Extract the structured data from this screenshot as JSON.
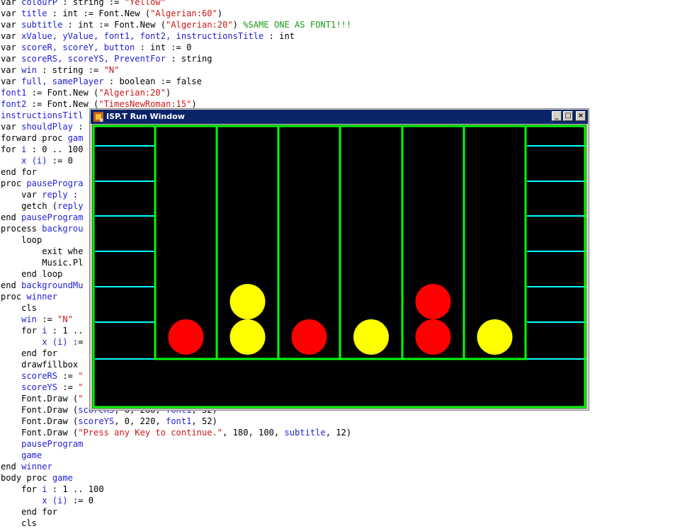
{
  "code_lines": [
    [
      {
        "t": "var ",
        "c": "kw"
      },
      {
        "t": "colourP",
        "c": "id"
      },
      {
        "t": " : string := ",
        "c": "kw"
      },
      {
        "t": "\"Yellow\"",
        "c": "str"
      }
    ],
    [
      {
        "t": "var ",
        "c": "kw"
      },
      {
        "t": "title",
        "c": "id"
      },
      {
        "t": " : int := Font.New (",
        "c": "kw"
      },
      {
        "t": "\"Algerian:60\"",
        "c": "str"
      },
      {
        "t": ")",
        "c": "kw"
      }
    ],
    [
      {
        "t": "var ",
        "c": "kw"
      },
      {
        "t": "subtitle",
        "c": "id"
      },
      {
        "t": " : int := Font.New (",
        "c": "kw"
      },
      {
        "t": "\"Algerian:20\"",
        "c": "str"
      },
      {
        "t": ") ",
        "c": "kw"
      },
      {
        "t": "%SAME ONE AS FONT1!!!",
        "c": "cm"
      }
    ],
    [
      {
        "t": "var ",
        "c": "kw"
      },
      {
        "t": "xValue, yValue, font1, font2, instructionsTitle",
        "c": "id"
      },
      {
        "t": " : int",
        "c": "kw"
      }
    ],
    [
      {
        "t": "var ",
        "c": "kw"
      },
      {
        "t": "scoreR, scoreY, button",
        "c": "id"
      },
      {
        "t": " : int := 0",
        "c": "kw"
      }
    ],
    [
      {
        "t": "var ",
        "c": "kw"
      },
      {
        "t": "scoreRS, scoreYS, PreventFor",
        "c": "id"
      },
      {
        "t": " : string",
        "c": "kw"
      }
    ],
    [
      {
        "t": "var ",
        "c": "kw"
      },
      {
        "t": "win",
        "c": "id"
      },
      {
        "t": " : string := ",
        "c": "kw"
      },
      {
        "t": "\"N\"",
        "c": "str"
      }
    ],
    [
      {
        "t": "var ",
        "c": "kw"
      },
      {
        "t": "full, samePlayer",
        "c": "id"
      },
      {
        "t": " : boolean := false",
        "c": "kw"
      }
    ],
    [
      {
        "t": "font1",
        "c": "id"
      },
      {
        "t": " := Font.New (",
        "c": "kw"
      },
      {
        "t": "\"Algerian:20\"",
        "c": "str"
      },
      {
        "t": ")",
        "c": "kw"
      }
    ],
    [
      {
        "t": "font2",
        "c": "id"
      },
      {
        "t": " := Font.New (",
        "c": "kw"
      },
      {
        "t": "\"TimesNewRoman:15\"",
        "c": "str"
      },
      {
        "t": ")",
        "c": "kw"
      }
    ],
    [
      {
        "t": "instructionsTitl",
        "c": "id"
      }
    ],
    [
      {
        "t": "var ",
        "c": "kw"
      },
      {
        "t": "shouldPlay",
        "c": "id"
      },
      {
        "t": " :",
        "c": "kw"
      }
    ],
    [
      {
        "t": "forward proc ",
        "c": "kw"
      },
      {
        "t": "gam",
        "c": "id"
      }
    ],
    [
      {
        "t": "for ",
        "c": "kw"
      },
      {
        "t": "i",
        "c": "id"
      },
      {
        "t": " : 0 .. 100",
        "c": "kw"
      }
    ],
    [
      {
        "t": "    ",
        "c": "kw"
      },
      {
        "t": "x (i)",
        "c": "id"
      },
      {
        "t": " := 0",
        "c": "kw"
      }
    ],
    [
      {
        "t": "end for",
        "c": "kw"
      }
    ],
    [
      {
        "t": "proc ",
        "c": "kw"
      },
      {
        "t": "pauseProgra",
        "c": "id"
      }
    ],
    [
      {
        "t": "    var ",
        "c": "kw"
      },
      {
        "t": "reply",
        "c": "id"
      },
      {
        "t": " :",
        "c": "kw"
      }
    ],
    [
      {
        "t": "    getch (",
        "c": "kw"
      },
      {
        "t": "reply",
        "c": "id"
      }
    ],
    [
      {
        "t": "end ",
        "c": "kw"
      },
      {
        "t": "pauseProgram",
        "c": "id"
      }
    ],
    [
      {
        "t": "process ",
        "c": "kw"
      },
      {
        "t": "backgrou",
        "c": "id"
      }
    ],
    [
      {
        "t": "    loop",
        "c": "kw"
      }
    ],
    [
      {
        "t": "        exit whe",
        "c": "kw"
      }
    ],
    [
      {
        "t": "        Music.Pl",
        "c": "kw"
      }
    ],
    [
      {
        "t": "    end loop",
        "c": "kw"
      }
    ],
    [
      {
        "t": "end ",
        "c": "kw"
      },
      {
        "t": "backgroundMu",
        "c": "id"
      }
    ],
    [
      {
        "t": "proc ",
        "c": "kw"
      },
      {
        "t": "winner",
        "c": "id"
      }
    ],
    [
      {
        "t": "    cls",
        "c": "kw"
      }
    ],
    [
      {
        "t": "    ",
        "c": "kw"
      },
      {
        "t": "win",
        "c": "id"
      },
      {
        "t": " := ",
        "c": "kw"
      },
      {
        "t": "\"N\"",
        "c": "str"
      }
    ],
    [
      {
        "t": "    for ",
        "c": "kw"
      },
      {
        "t": "i",
        "c": "id"
      },
      {
        "t": " : 1 ..",
        "c": "kw"
      }
    ],
    [
      {
        "t": "        ",
        "c": "kw"
      },
      {
        "t": "x (i)",
        "c": "id"
      },
      {
        "t": " :=",
        "c": "kw"
      }
    ],
    [
      {
        "t": "    end for",
        "c": "kw"
      }
    ],
    [
      {
        "t": "    drawfillbox",
        "c": "kw"
      }
    ],
    [
      {
        "t": "    ",
        "c": "kw"
      },
      {
        "t": "scoreRS",
        "c": "id"
      },
      {
        "t": " := ",
        "c": "kw"
      },
      {
        "t": "\"",
        "c": "str"
      }
    ],
    [
      {
        "t": "    ",
        "c": "kw"
      },
      {
        "t": "scoreYS",
        "c": "id"
      },
      {
        "t": " := ",
        "c": "kw"
      },
      {
        "t": "\"",
        "c": "str"
      }
    ],
    [
      {
        "t": "    Font.Draw (",
        "c": "kw"
      },
      {
        "t": "\"",
        "c": "str"
      }
    ],
    [
      {
        "t": "    Font.Draw (",
        "c": "kw"
      },
      {
        "t": "scoreRS",
        "c": "id"
      },
      {
        "t": ", 0, 260, ",
        "c": "kw"
      },
      {
        "t": "font1",
        "c": "id"
      },
      {
        "t": ", 52)",
        "c": "kw"
      }
    ],
    [
      {
        "t": "    Font.Draw (",
        "c": "kw"
      },
      {
        "t": "scoreYS",
        "c": "id"
      },
      {
        "t": ", 0, 220, ",
        "c": "kw"
      },
      {
        "t": "font1",
        "c": "id"
      },
      {
        "t": ", 52)",
        "c": "kw"
      }
    ],
    [
      {
        "t": "    Font.Draw (",
        "c": "kw"
      },
      {
        "t": "\"Press any Key to continue.\"",
        "c": "str"
      },
      {
        "t": ", 180, 100, ",
        "c": "kw"
      },
      {
        "t": "subtitle",
        "c": "id"
      },
      {
        "t": ", 12)",
        "c": "kw"
      }
    ],
    [
      {
        "t": "    ",
        "c": "kw"
      },
      {
        "t": "pauseProgram",
        "c": "id"
      }
    ],
    [
      {
        "t": "    ",
        "c": "kw"
      },
      {
        "t": "game",
        "c": "id"
      }
    ],
    [
      {
        "t": "end ",
        "c": "kw"
      },
      {
        "t": "winner",
        "c": "id"
      }
    ],
    [
      {
        "t": "body proc ",
        "c": "kw"
      },
      {
        "t": "game",
        "c": "id"
      }
    ],
    [
      {
        "t": "    for ",
        "c": "kw"
      },
      {
        "t": "i",
        "c": "id"
      },
      {
        "t": " : 1 .. 100",
        "c": "kw"
      }
    ],
    [
      {
        "t": "        ",
        "c": "kw"
      },
      {
        "t": "x (i)",
        "c": "id"
      },
      {
        "t": " := 0",
        "c": "kw"
      }
    ],
    [
      {
        "t": "    end for",
        "c": "kw"
      }
    ],
    [
      {
        "t": "    cls",
        "c": "kw"
      }
    ]
  ],
  "run_window": {
    "title": "ISP.T Run Window",
    "minimize_glyph": "_",
    "maximize_glyph": "□",
    "close_glyph": "×"
  },
  "game": {
    "columns": 7,
    "pieces": [
      {
        "column": 1,
        "row_from_bottom": 1,
        "color": "red"
      },
      {
        "column": 2,
        "row_from_bottom": 1,
        "color": "yellow"
      },
      {
        "column": 2,
        "row_from_bottom": 2,
        "color": "yellow"
      },
      {
        "column": 3,
        "row_from_bottom": 1,
        "color": "red"
      },
      {
        "column": 4,
        "row_from_bottom": 1,
        "color": "yellow"
      },
      {
        "column": 5,
        "row_from_bottom": 1,
        "color": "red"
      },
      {
        "column": 5,
        "row_from_bottom": 2,
        "color": "red"
      },
      {
        "column": 6,
        "row_from_bottom": 1,
        "color": "yellow"
      }
    ],
    "colors": {
      "background": "#000000",
      "grid": "#00ff00",
      "side_lines": "#00ffff",
      "red": "#ff0000",
      "yellow": "#ffff00"
    }
  }
}
